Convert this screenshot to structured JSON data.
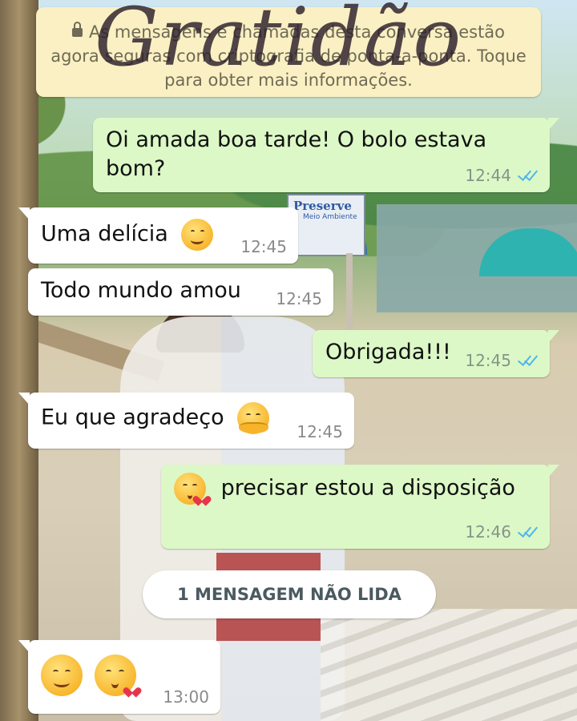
{
  "notice": {
    "text": "As mensagens e chamadas desta conversa estão agora seguras com criptografia de ponta-a-ponta. Toque para obter mais informações."
  },
  "overlay": {
    "script_text": "Gratidão"
  },
  "background": {
    "sign_title": "Preserve",
    "sign_subtitle": "Meio Ambiente"
  },
  "messages": [
    {
      "direction": "out",
      "text": "Oi amada boa tarde! O bolo estava bom?",
      "time": "12:44",
      "status": "read"
    },
    {
      "direction": "in",
      "text": "Uma delícia",
      "emoji": "savoring-food-emoji-icon",
      "time": "12:45"
    },
    {
      "direction": "in",
      "text": "Todo mundo amou",
      "time": "12:45"
    },
    {
      "direction": "out",
      "text": "Obrigada!!!",
      "time": "12:45",
      "status": "read"
    },
    {
      "direction": "in",
      "text": "Eu que agradeço",
      "emoji": "hugging-face-emoji-icon",
      "time": "12:45"
    },
    {
      "direction": "out",
      "text": "precisar estou a disposição",
      "emoji": "kissing-heart-emoji-icon",
      "time": "12:46",
      "status": "read"
    },
    {
      "direction": "in",
      "text": "",
      "emoji": [
        "relieved-face-emoji-icon",
        "kissing-heart-emoji-icon"
      ],
      "time": "13:00"
    }
  ],
  "unread_divider": {
    "label": "1 MENSAGEM NÃO LIDA"
  },
  "colors": {
    "outgoing_bubble": "#dcf8c6",
    "incoming_bubble": "#ffffff",
    "read_ticks": "#4fb6ec",
    "notice_bg": "#fbf0c3"
  }
}
